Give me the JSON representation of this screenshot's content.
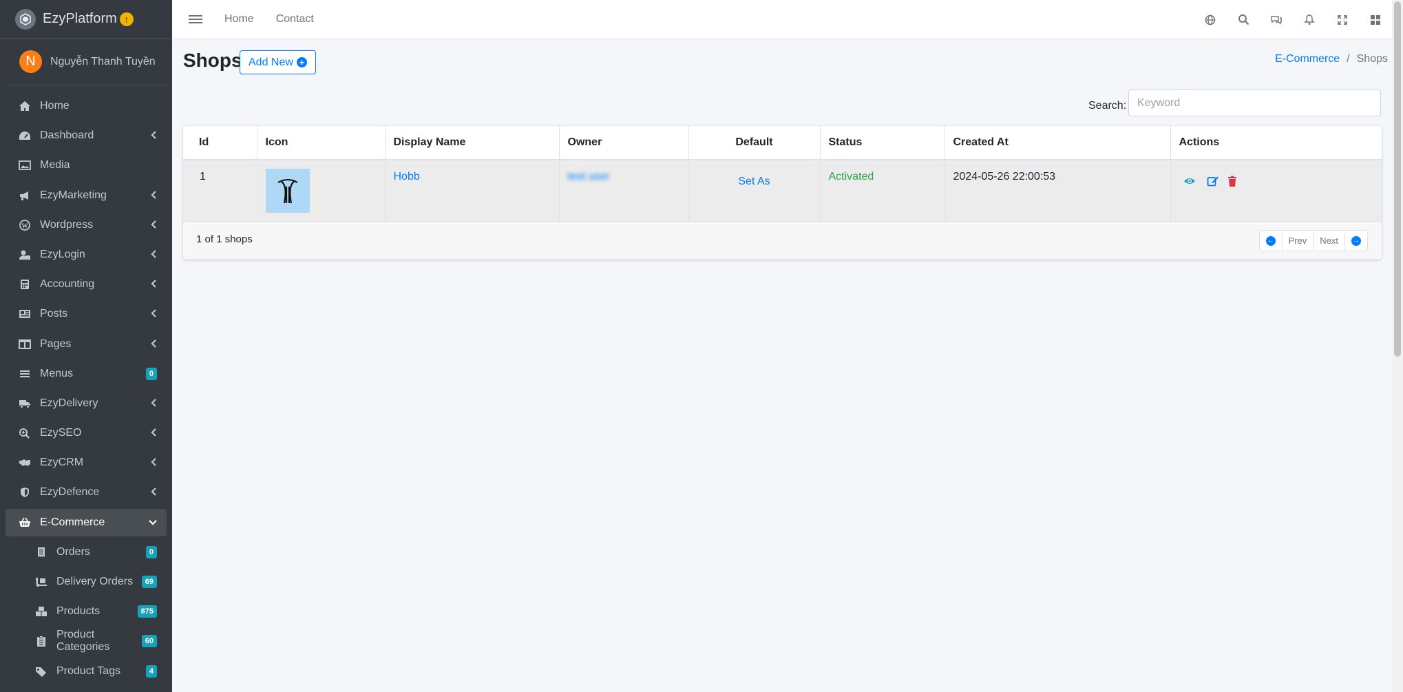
{
  "brand": {
    "name": "EzyPlatform"
  },
  "user": {
    "initial": "N",
    "name": "Nguyễn Thanh Tuyền"
  },
  "sidebar": {
    "items": [
      {
        "label": "Home",
        "icon": "home-icon"
      },
      {
        "label": "Dashboard",
        "icon": "tachometer-icon"
      },
      {
        "label": "Media",
        "icon": "image-icon"
      },
      {
        "label": "EzyMarketing",
        "icon": "megaphone-icon"
      },
      {
        "label": "Wordpress",
        "icon": "wordpress-icon"
      },
      {
        "label": "EzyLogin",
        "icon": "user-lock-icon"
      },
      {
        "label": "Accounting",
        "icon": "calculator-icon"
      },
      {
        "label": "Posts",
        "icon": "newspaper-icon"
      },
      {
        "label": "Pages",
        "icon": "columns-icon"
      },
      {
        "label": "Menus",
        "icon": "bars-icon",
        "badge": "0"
      },
      {
        "label": "EzyDelivery",
        "icon": "truck-icon"
      },
      {
        "label": "EzySEO",
        "icon": "search-plus-icon"
      },
      {
        "label": "EzyCRM",
        "icon": "handshake-icon"
      },
      {
        "label": "EzyDefence",
        "icon": "shield-icon"
      },
      {
        "label": "E-Commerce",
        "icon": "basket-icon"
      }
    ],
    "sub_items": [
      {
        "label": "Orders",
        "icon": "receipt-icon",
        "badge": "0"
      },
      {
        "label": "Delivery Orders",
        "icon": "dolly-icon",
        "badge": "69"
      },
      {
        "label": "Products",
        "icon": "boxes-icon",
        "badge": "875"
      },
      {
        "label": "Product Categories",
        "icon": "clipboard-list-icon",
        "badge": "60"
      },
      {
        "label": "Product Tags",
        "icon": "tags-icon",
        "badge": "4"
      }
    ]
  },
  "topbar": {
    "home": "Home",
    "contact": "Contact"
  },
  "header": {
    "title": "Shops",
    "add_new": "Add New"
  },
  "breadcrumb": {
    "parent": "E-Commerce",
    "current": "Shops"
  },
  "search": {
    "label": "Search:",
    "placeholder": "Keyword"
  },
  "table": {
    "columns": [
      "Id",
      "Icon",
      "Display Name",
      "Owner",
      "Default",
      "Status",
      "Created At",
      "Actions"
    ],
    "rows": [
      {
        "id": "1",
        "display_name": "Hobb",
        "owner": "test user",
        "default": "Set As",
        "status": "Activated",
        "created_at": "2024-05-26 22:00:53"
      }
    ]
  },
  "footer": {
    "count": "1 of 1 shops",
    "prev": "Prev",
    "next": "Next"
  },
  "colors": {
    "sidebar_bg": "#343a40",
    "primary": "#007bff",
    "success": "#28a745",
    "danger": "#dc3545",
    "info": "#17a2b8"
  }
}
